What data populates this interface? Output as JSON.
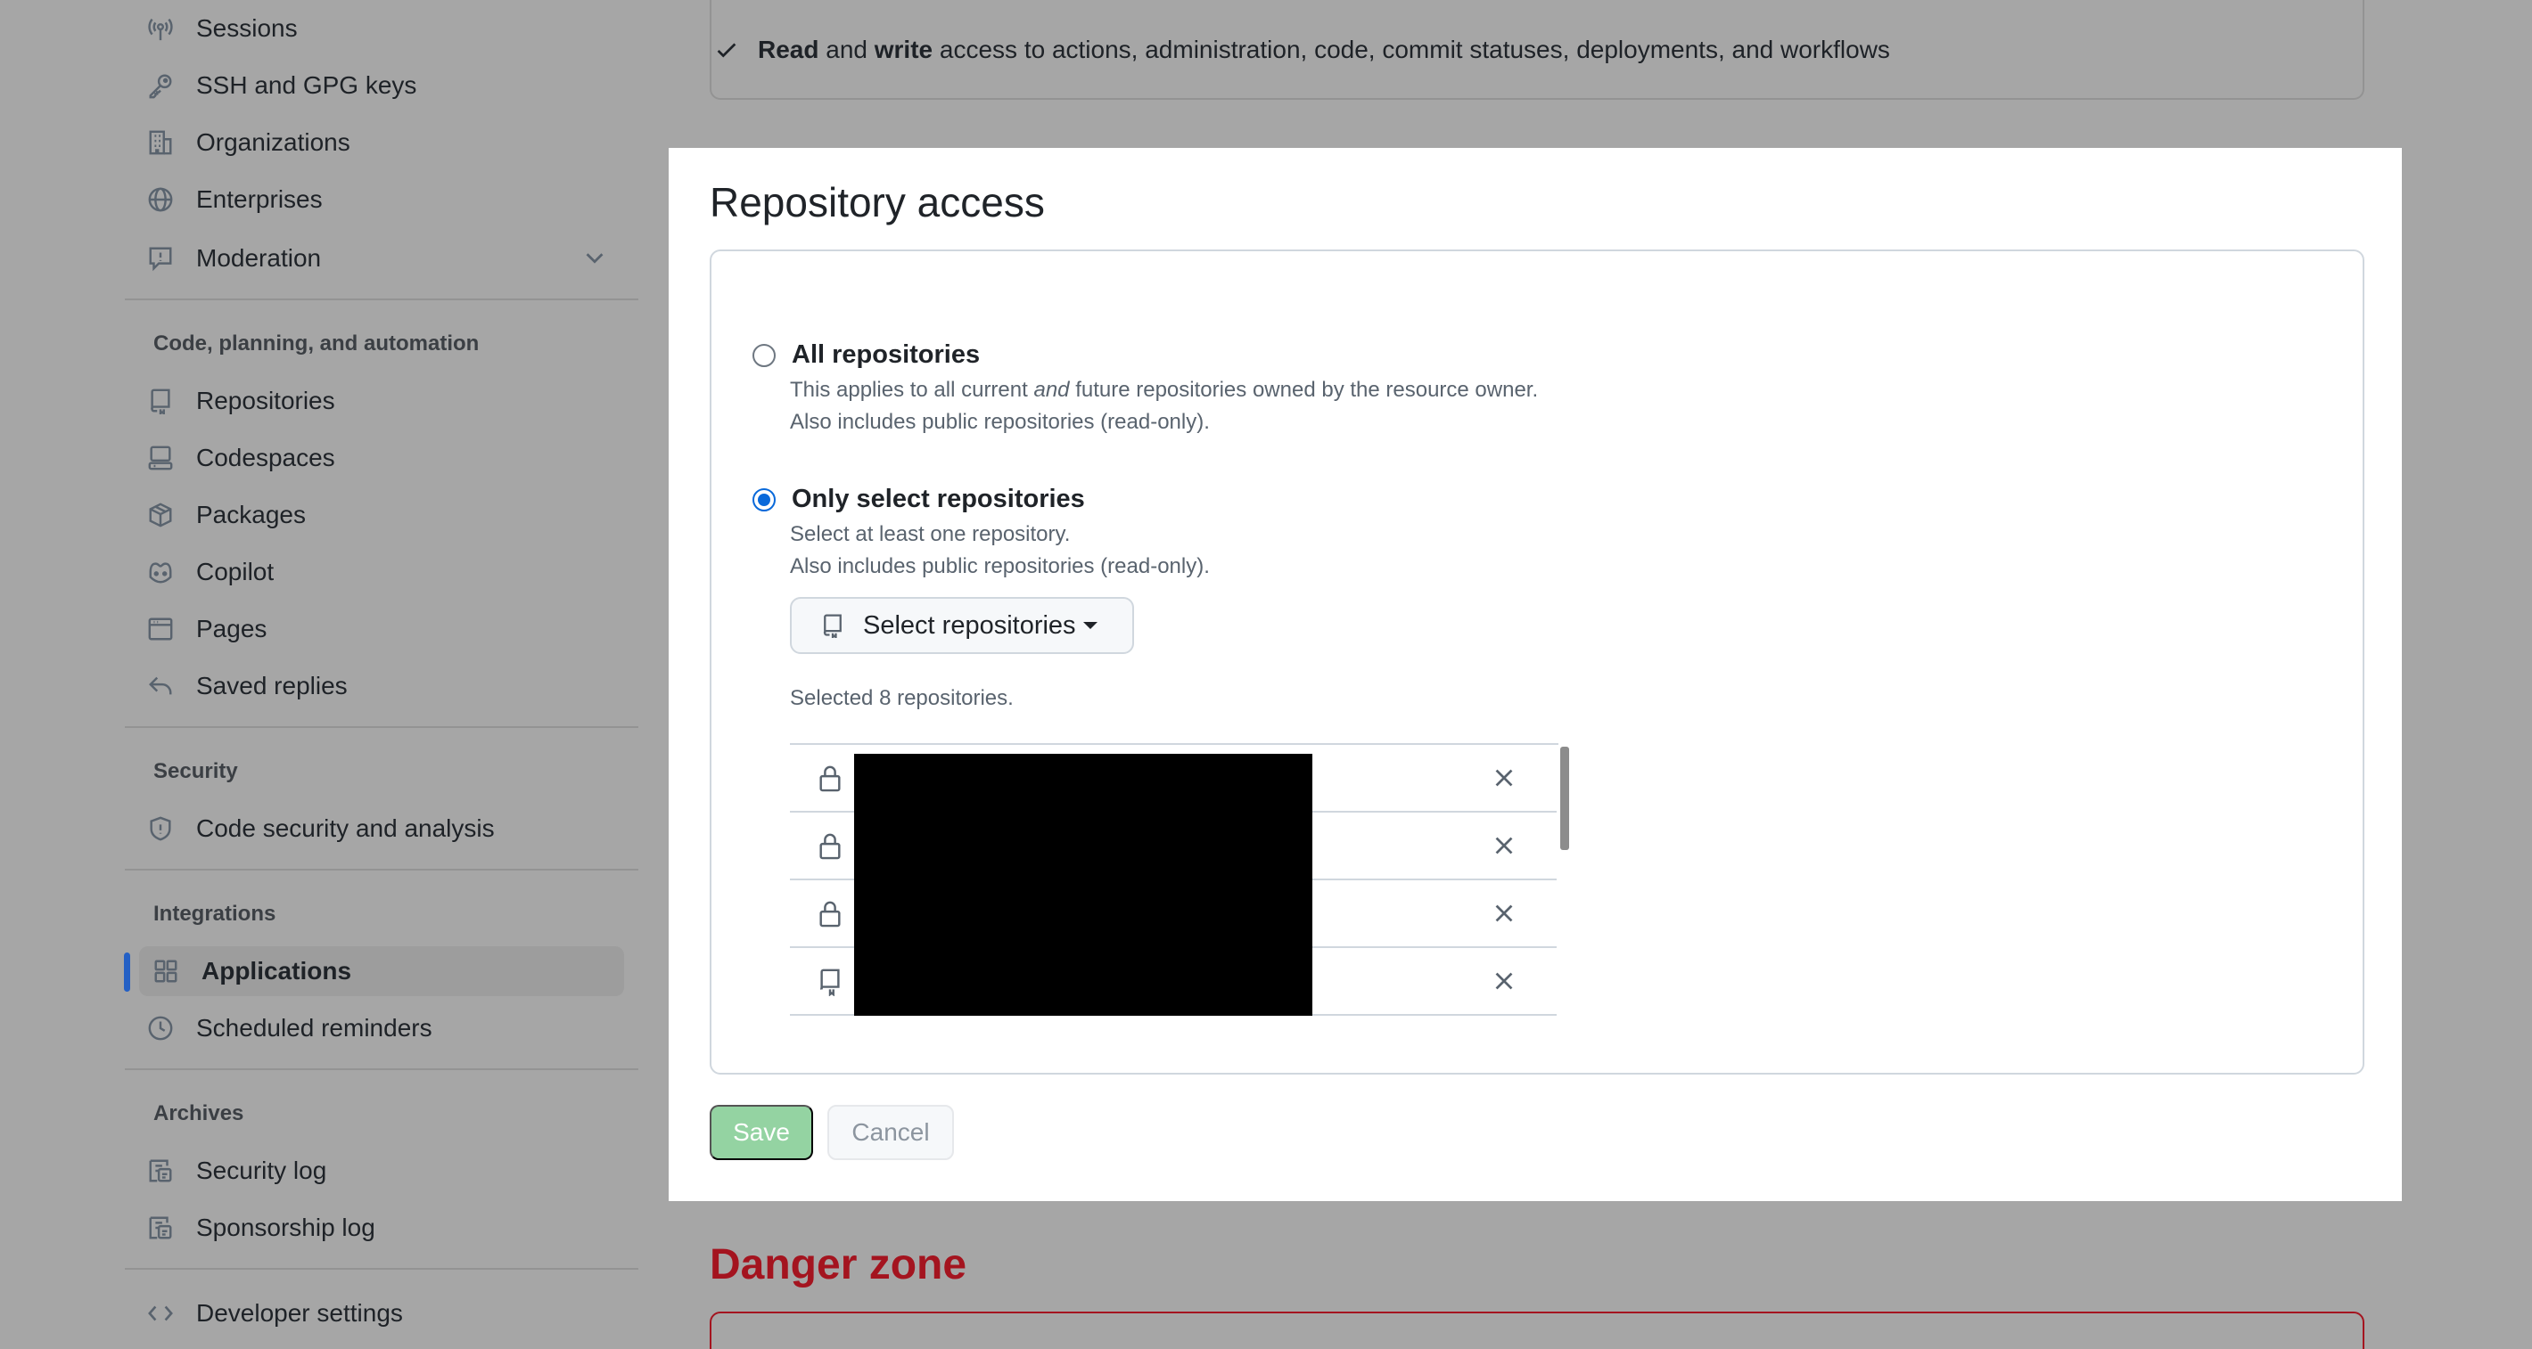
{
  "sidebar": {
    "items_top": [
      {
        "label": "Sessions",
        "icon": "broadcast-icon"
      },
      {
        "label": "SSH and GPG keys",
        "icon": "key-icon"
      },
      {
        "label": "Organizations",
        "icon": "organization-icon"
      },
      {
        "label": "Enterprises",
        "icon": "globe-icon"
      },
      {
        "label": "Moderation",
        "icon": "report-icon"
      }
    ],
    "section_code": "Code, planning, and automation",
    "items_code": [
      {
        "label": "Repositories",
        "icon": "repo-icon"
      },
      {
        "label": "Codespaces",
        "icon": "codespaces-icon"
      },
      {
        "label": "Packages",
        "icon": "package-icon"
      },
      {
        "label": "Copilot",
        "icon": "copilot-icon"
      },
      {
        "label": "Pages",
        "icon": "browser-icon"
      },
      {
        "label": "Saved replies",
        "icon": "reply-icon"
      }
    ],
    "section_security": "Security",
    "items_security": [
      {
        "label": "Code security and analysis",
        "icon": "shield-icon"
      }
    ],
    "section_integrations": "Integrations",
    "items_integrations": [
      {
        "label": "Applications",
        "icon": "apps-icon",
        "active": true
      },
      {
        "label": "Scheduled reminders",
        "icon": "clock-icon"
      }
    ],
    "section_archives": "Archives",
    "items_archives": [
      {
        "label": "Security log",
        "icon": "log-icon"
      },
      {
        "label": "Sponsorship log",
        "icon": "log-icon"
      }
    ],
    "items_bottom": [
      {
        "label": "Developer settings",
        "icon": "code-icon"
      }
    ]
  },
  "permissions": {
    "read": "Read",
    "and": "and",
    "write": "write",
    "rest": "access to actions, administration, code, commit statuses, deployments, and workflows"
  },
  "modal": {
    "title": "Repository access",
    "all": {
      "label": "All repositories",
      "desc_pre": "This applies to all current",
      "desc_em": "and",
      "desc_post": "future repositories owned by the resource owner.",
      "desc2": "Also includes public repositories (read-only).",
      "checked": false
    },
    "select": {
      "label": "Only select repositories",
      "desc1": "Select at least one repository.",
      "desc2": "Also includes public repositories (read-only).",
      "checked": true
    },
    "select_button": "Select repositories",
    "selected_count": "Selected 8 repositories.",
    "repo_rows": [
      {
        "icon": "lock-icon"
      },
      {
        "icon": "lock-icon"
      },
      {
        "icon": "lock-icon"
      },
      {
        "icon": "repo-icon"
      }
    ],
    "save": "Save",
    "cancel": "Cancel"
  },
  "danger_zone": {
    "title": "Danger zone"
  },
  "colors": {
    "accent": "#0969da",
    "active_bar": "#2460c5",
    "danger": "#a4141f",
    "save_disabled": "#94d3a2"
  }
}
